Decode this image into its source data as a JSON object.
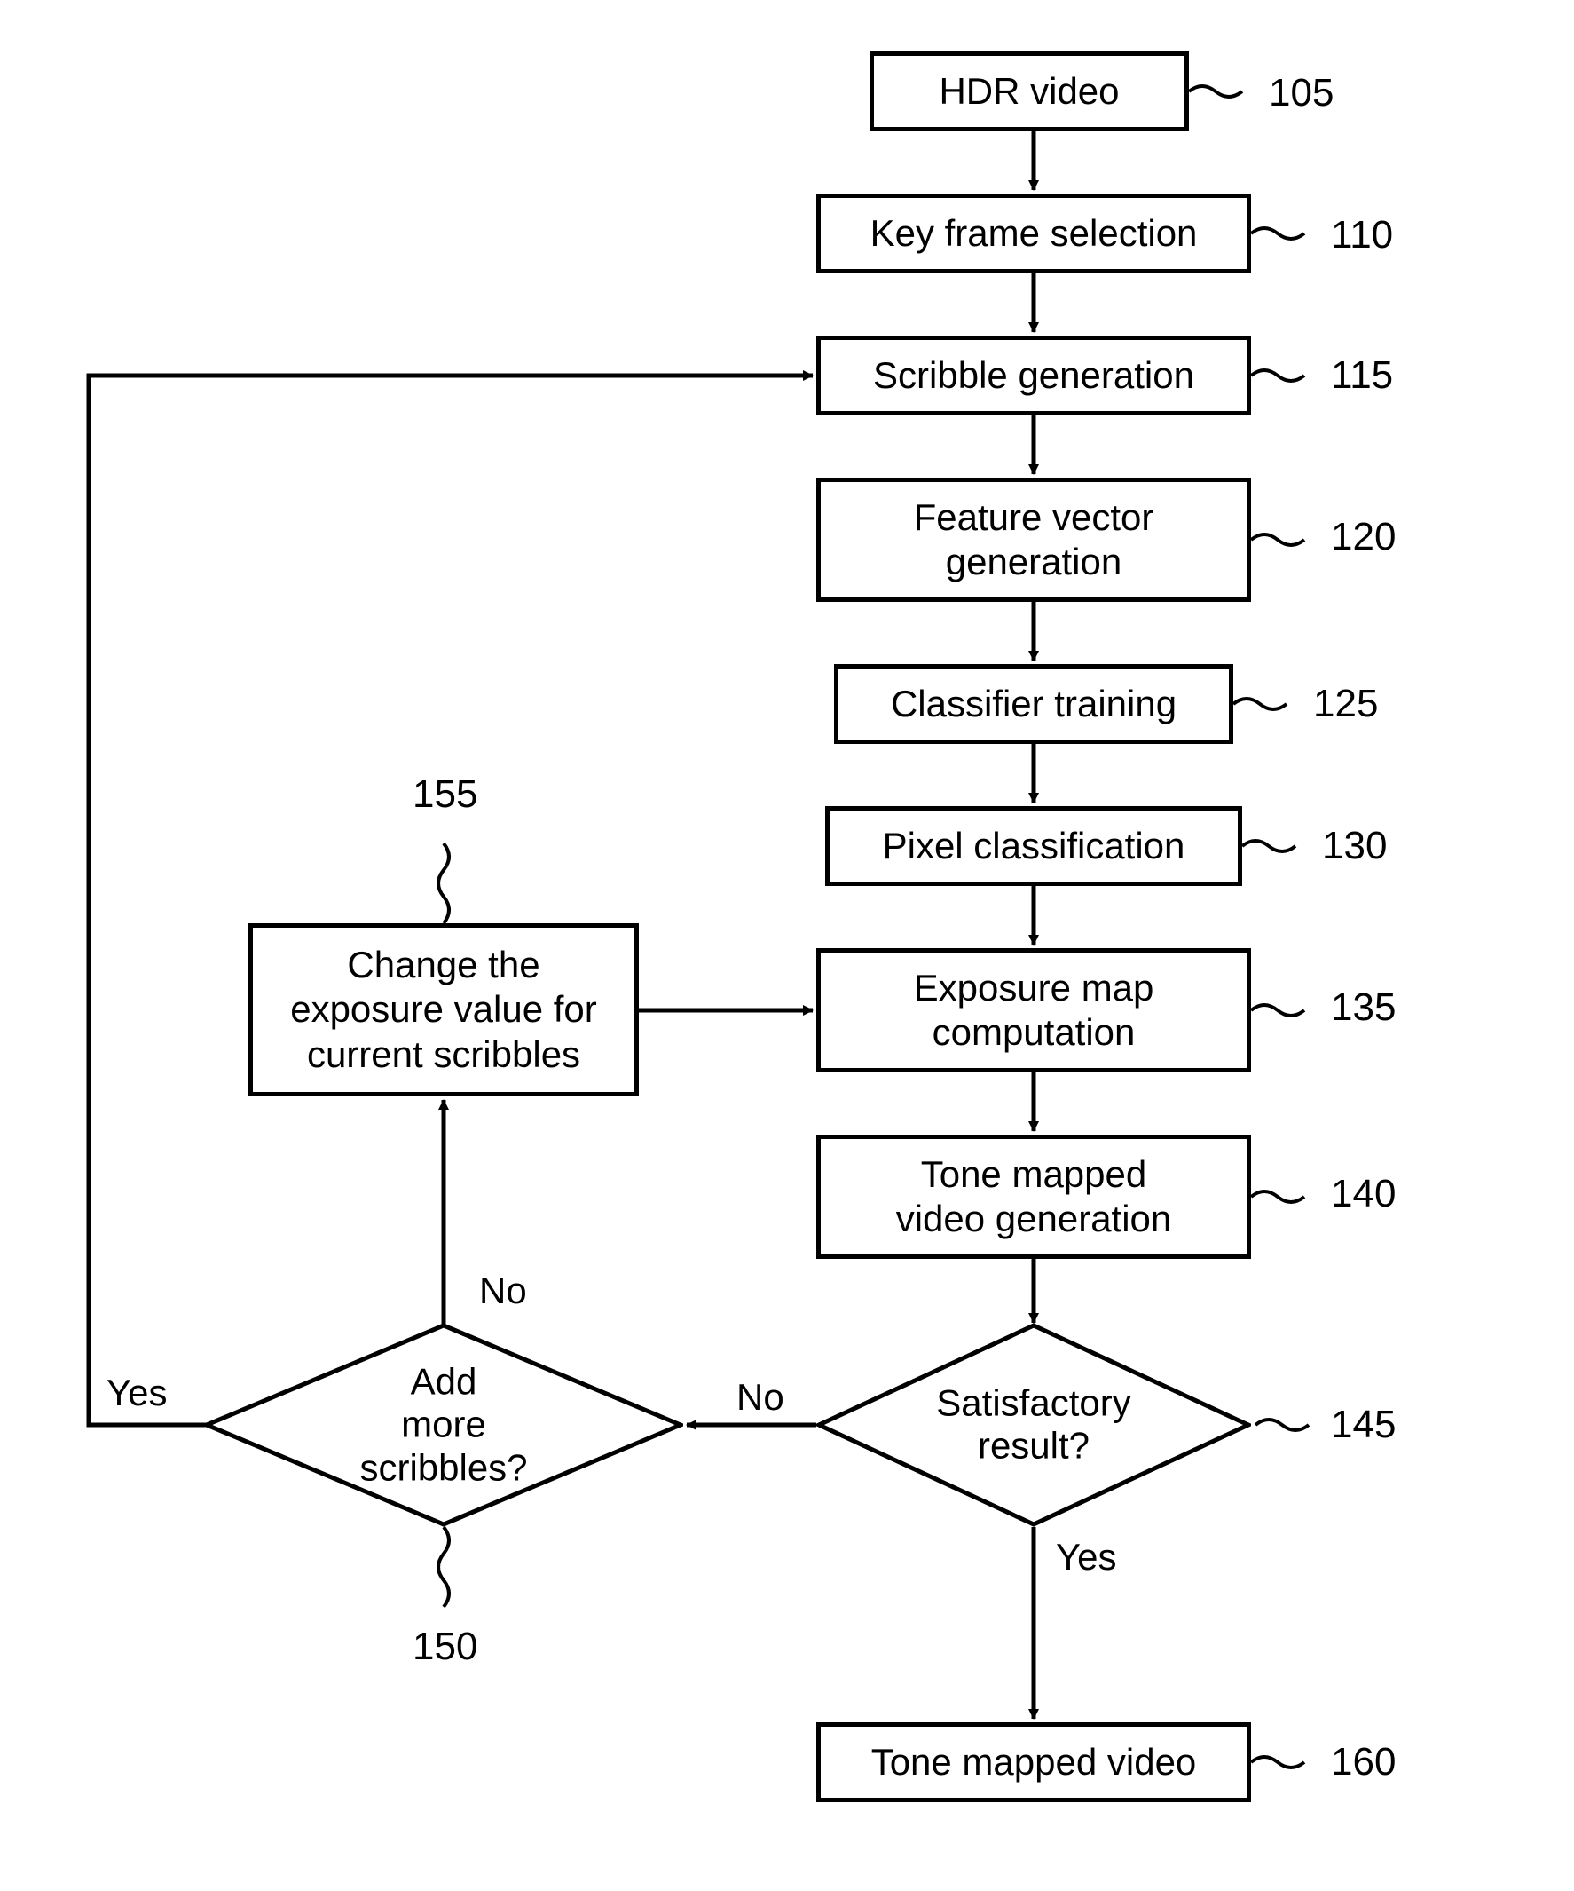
{
  "nodes": {
    "n105": {
      "text": "HDR video",
      "ref": "105"
    },
    "n110": {
      "text": "Key frame selection",
      "ref": "110"
    },
    "n115": {
      "text": "Scribble generation",
      "ref": "115"
    },
    "n120": {
      "text": "Feature vector\ngeneration",
      "ref": "120"
    },
    "n125": {
      "text": "Classifier training",
      "ref": "125"
    },
    "n130": {
      "text": "Pixel classification",
      "ref": "130"
    },
    "n135": {
      "text": "Exposure map\ncomputation",
      "ref": "135"
    },
    "n140": {
      "text": "Tone mapped\nvideo generation",
      "ref": "140"
    },
    "n145": {
      "text": "Satisfactory\nresult?",
      "ref": "145"
    },
    "n150": {
      "text": "Add\nmore scribbles?",
      "ref": "150"
    },
    "n155": {
      "text": "Change the\nexposure value for\ncurrent scribbles",
      "ref": "155"
    },
    "n160": {
      "text": "Tone mapped video",
      "ref": "160"
    }
  },
  "edgeLabels": {
    "e145_no": "No",
    "e145_yes": "Yes",
    "e150_no": "No",
    "e150_yes": "Yes"
  }
}
